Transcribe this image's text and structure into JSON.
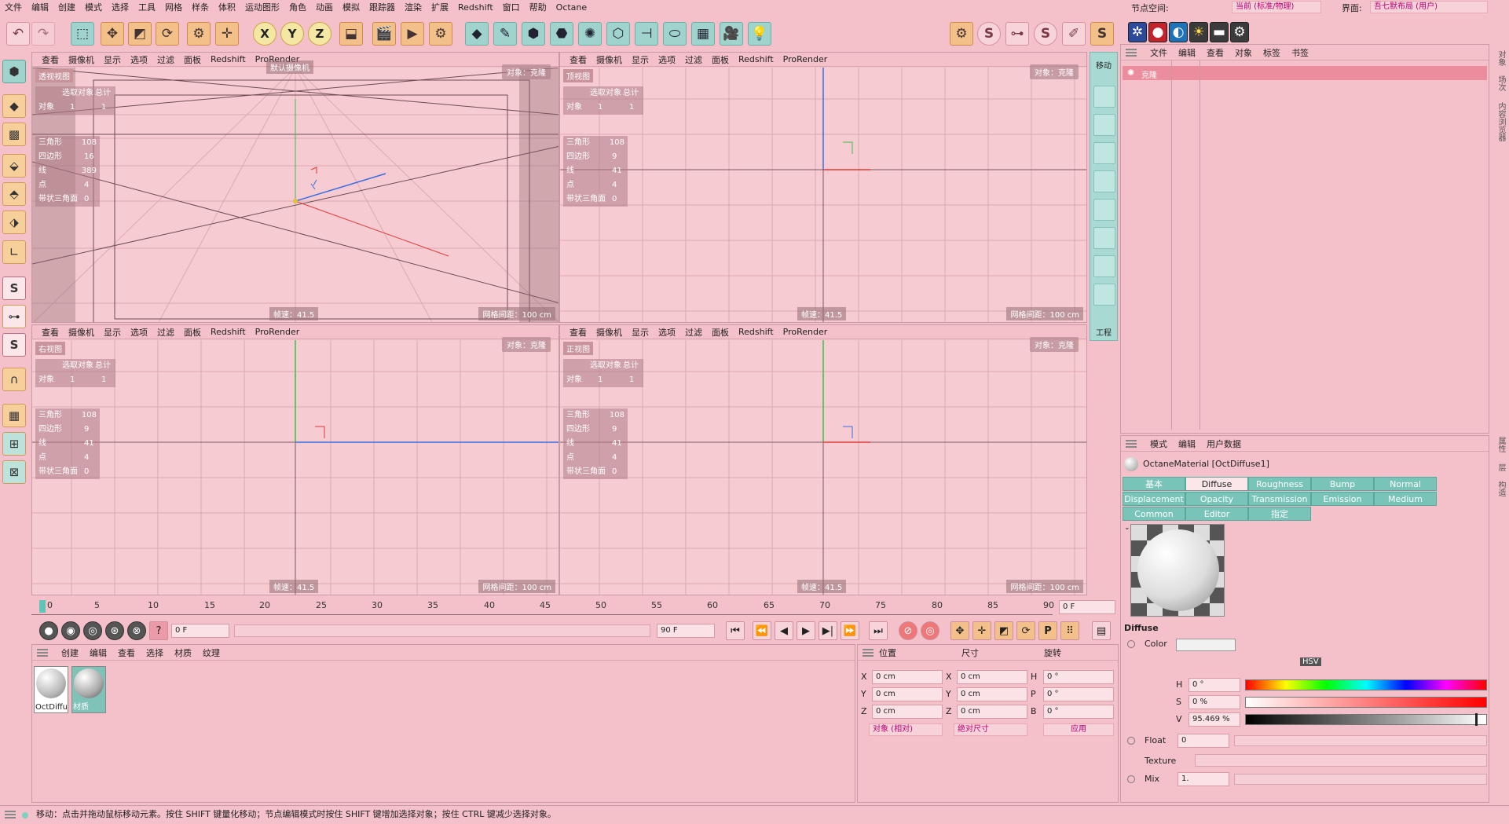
{
  "menu": [
    "文件",
    "编辑",
    "创建",
    "模式",
    "选择",
    "工具",
    "网格",
    "样条",
    "体积",
    "运动图形",
    "角色",
    "动画",
    "模拟",
    "跟踪器",
    "渲染",
    "扩展",
    "Redshift",
    "窗口",
    "帮助",
    "Octane"
  ],
  "node_space": {
    "label": "节点空间:",
    "value": "当前 (标准/物理)"
  },
  "layout": {
    "label": "界面:",
    "value": "吾七默布局 (用户)"
  },
  "viewport_menu": [
    "查看",
    "摄像机",
    "显示",
    "选项",
    "过滤",
    "面板",
    "Redshift",
    "ProRender"
  ],
  "viewports": [
    {
      "name": "透视视图",
      "camera": "默认摄像机",
      "object_label": "对象：克隆",
      "fps": "帧速：41.5",
      "grid": "网格间距：100 cm",
      "stats_header": [
        "选取对象",
        "总计"
      ],
      "obj_row": [
        "对象",
        "1",
        "1"
      ],
      "stats": [
        [
          "三角形",
          "108"
        ],
        [
          "四边形",
          "16"
        ],
        [
          "线",
          "389"
        ],
        [
          "点",
          "4"
        ],
        [
          "带状三角面",
          "0"
        ]
      ]
    },
    {
      "name": "顶视图",
      "camera": "",
      "object_label": "对象：克隆",
      "fps": "帧速：41.5",
      "grid": "网格间距：100 cm",
      "stats_header": [
        "选取对象",
        "总计"
      ],
      "obj_row": [
        "对象",
        "1",
        "1"
      ],
      "stats": [
        [
          "三角形",
          "108"
        ],
        [
          "四边形",
          "9"
        ],
        [
          "线",
          "41"
        ],
        [
          "点",
          "4"
        ],
        [
          "带状三角面",
          "0"
        ]
      ]
    },
    {
      "name": "右视图",
      "camera": "",
      "object_label": "对象：克隆",
      "fps": "帧速：41.5",
      "grid": "网格间距：100 cm",
      "stats_header": [
        "选取对象",
        "总计"
      ],
      "obj_row": [
        "对象",
        "1",
        "1"
      ],
      "stats": [
        [
          "三角形",
          "108"
        ],
        [
          "四边形",
          "9"
        ],
        [
          "线",
          "41"
        ],
        [
          "点",
          "4"
        ],
        [
          "带状三角面",
          "0"
        ]
      ]
    },
    {
      "name": "正视图",
      "camera": "",
      "object_label": "对象：克隆",
      "fps": "帧速：41.5",
      "grid": "网格间距：100 cm",
      "stats_header": [
        "选取对象",
        "总计"
      ],
      "obj_row": [
        "对象",
        "1",
        "1"
      ],
      "stats": [
        [
          "三角形",
          "108"
        ],
        [
          "四边形",
          "9"
        ],
        [
          "线",
          "41"
        ],
        [
          "点",
          "4"
        ],
        [
          "带状三角面",
          "0"
        ]
      ]
    }
  ],
  "side_strip": {
    "top": "移动",
    "bottom": "工程"
  },
  "objects_panel": {
    "menu": [
      "文件",
      "编辑",
      "查看",
      "对象",
      "标签",
      "书签"
    ],
    "item": "克隆"
  },
  "right_tabs": [
    "对象",
    "场次",
    "内容浏览器",
    "属性",
    "层",
    "构造"
  ],
  "timeline": {
    "ticks": [
      "0",
      "5",
      "10",
      "15",
      "20",
      "25",
      "30",
      "35",
      "40",
      "45",
      "50",
      "55",
      "60",
      "65",
      "70",
      "75",
      "80",
      "85",
      "90"
    ],
    "current": "0 F"
  },
  "playback": {
    "start": "0 F",
    "end": "90 F"
  },
  "materials_panel": {
    "menu": [
      "创建",
      "编辑",
      "查看",
      "选择",
      "材质",
      "纹理"
    ],
    "items": [
      "OctDiffu",
      "材质"
    ]
  },
  "coords": {
    "headers": [
      "位置",
      "尺寸",
      "旋转"
    ],
    "rows": [
      {
        "a": "X",
        "pos": "0 cm",
        "b": "X",
        "size": "0 cm",
        "c": "H",
        "rot": "0 °"
      },
      {
        "a": "Y",
        "pos": "0 cm",
        "b": "Y",
        "size": "0 cm",
        "c": "P",
        "rot": "0 °"
      },
      {
        "a": "Z",
        "pos": "0 cm",
        "b": "Z",
        "size": "0 cm",
        "c": "B",
        "rot": "0 °"
      }
    ],
    "mode": "对象 (相对)",
    "size_mode": "绝对尺寸",
    "apply": "应用"
  },
  "attributes": {
    "menu": [
      "模式",
      "编辑",
      "用户数据"
    ],
    "title": "OctaneMaterial [OctDiffuse1]",
    "tabs_row1": [
      "基本",
      "Diffuse",
      "Roughness",
      "Bump",
      "Normal"
    ],
    "tabs_row2": [
      "Displacement",
      "Opacity",
      "Transmission",
      "Emission",
      "Medium"
    ],
    "tabs_row3": [
      "Common",
      "Editor",
      "指定"
    ],
    "section": "Diffuse",
    "color_label": "Color",
    "hsv": "HSV",
    "h": {
      "label": "H",
      "value": "0 °"
    },
    "s": {
      "label": "S",
      "value": "0 %"
    },
    "v": {
      "label": "V",
      "value": "95.469 %"
    },
    "float": {
      "label": "Float",
      "value": "0"
    },
    "texture_label": "Texture",
    "mix": {
      "label": "Mix",
      "value": "1."
    }
  },
  "status": "移动：点击并拖动鼠标移动元素。按住 SHIFT 键量化移动；节点编辑模式时按住 SHIFT 键增加选择对象；按住 CTRL 键减少选择对象。"
}
